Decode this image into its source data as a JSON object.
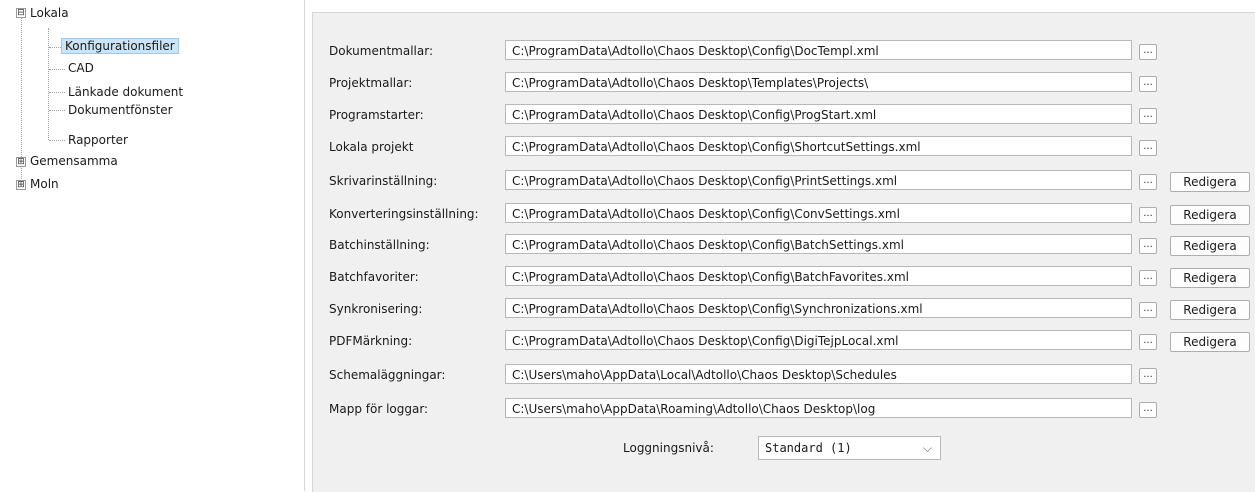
{
  "tree": {
    "root": {
      "label": "Lokala",
      "expander": "⊟"
    },
    "children": [
      {
        "label": "Konfigurationsfiler",
        "selected": true
      },
      {
        "label": "CAD"
      },
      {
        "label": "Länkade dokument"
      },
      {
        "label": "Dokumentfönster"
      },
      {
        "label": "Rapporter"
      }
    ],
    "siblings": [
      {
        "label": "Gemensamma",
        "expander": "⊞"
      },
      {
        "label": "Moln",
        "expander": "⊞"
      }
    ]
  },
  "settings": [
    {
      "label": "Dokumentmallar:",
      "value": "C:\\ProgramData\\Adtollo\\Chaos Desktop\\Config\\DocTempl.xml",
      "browse": "...",
      "edit": null
    },
    {
      "label": "Projektmallar:",
      "value": "C:\\ProgramData\\Adtollo\\Chaos Desktop\\Templates\\Projects\\",
      "browse": "...",
      "edit": null
    },
    {
      "label": "Programstarter:",
      "value": "C:\\ProgramData\\Adtollo\\Chaos Desktop\\Config\\ProgStart.xml",
      "browse": "...",
      "edit": null
    },
    {
      "label": "Lokala projekt",
      "value": "C:\\ProgramData\\Adtollo\\Chaos Desktop\\Config\\ShortcutSettings.xml",
      "browse": "...",
      "edit": null
    },
    {
      "label": "Skrivarinställning:",
      "value": "C:\\ProgramData\\Adtollo\\Chaos Desktop\\Config\\PrintSettings.xml",
      "browse": "...",
      "edit": "Redigera"
    },
    {
      "label": "Konverteringsinställning:",
      "value": "C:\\ProgramData\\Adtollo\\Chaos Desktop\\Config\\ConvSettings.xml",
      "browse": "...",
      "edit": "Redigera"
    },
    {
      "label": "Batchinställning:",
      "value": "C:\\ProgramData\\Adtollo\\Chaos Desktop\\Config\\BatchSettings.xml",
      "browse": "...",
      "edit": "Redigera"
    },
    {
      "label": "Batchfavoriter:",
      "value": "C:\\ProgramData\\Adtollo\\Chaos Desktop\\Config\\BatchFavorites.xml",
      "browse": "...",
      "edit": "Redigera"
    },
    {
      "label": "Synkronisering:",
      "value": "C:\\ProgramData\\Adtollo\\Chaos Desktop\\Config\\Synchronizations.xml",
      "browse": "...",
      "edit": "Redigera"
    },
    {
      "label": "PDFMärkning:",
      "value": "C:\\ProgramData\\Adtollo\\Chaos Desktop\\Config\\DigiTejpLocal.xml",
      "browse": "...",
      "edit": "Redigera"
    },
    {
      "label": "Schemaläggningar:",
      "value": "C:\\Users\\maho\\AppData\\Local\\Adtollo\\Chaos Desktop\\Schedules",
      "browse": "...",
      "edit": null
    },
    {
      "label": "Mapp för loggar:",
      "value": "C:\\Users\\maho\\AppData\\Roaming\\Adtollo\\Chaos Desktop\\log",
      "browse": "...",
      "edit": null
    }
  ],
  "logging": {
    "label": "Loggningsnivå:",
    "selected": "Standard (1)",
    "chevron": "⌵"
  }
}
